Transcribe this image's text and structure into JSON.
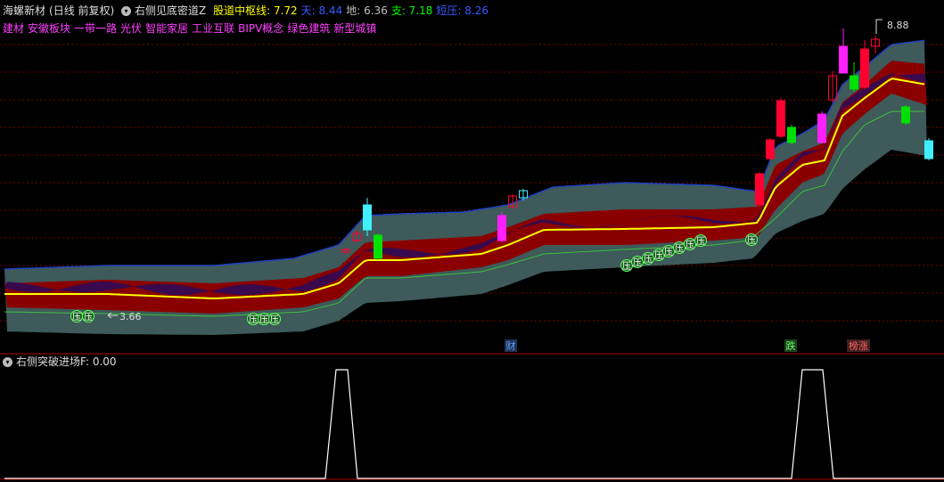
{
  "main_header": {
    "stock_name": "海螺新材",
    "period": "(日线 前复权)",
    "indicator": "右侧见底密道Z",
    "items": [
      {
        "label": "股道中枢线:",
        "value": "7.72",
        "color": "#ffff00"
      },
      {
        "label": "天:",
        "value": "8.44",
        "color": "#3a5bff"
      },
      {
        "label": "地:",
        "value": "6.36",
        "color": "#c0c0c0"
      },
      {
        "label": "支:",
        "value": "7.18",
        "color": "#00ff00"
      },
      {
        "label": "短压:",
        "value": "8.26",
        "color": "#3a5bff"
      }
    ]
  },
  "tags": [
    "建材",
    "安徽板块",
    "一带一路",
    "光伏",
    "智能家居",
    "工业互联",
    "BIPV概念",
    "绿色建筑",
    "新型城镇"
  ],
  "annotations": {
    "high_price": "8.88",
    "low_price": "3.66",
    "pressure_label": "压",
    "signals": [
      "财",
      "跌",
      "榜涨"
    ]
  },
  "sub_header": {
    "indicator": "右侧突破进场F",
    "value": ": 0.00"
  },
  "colors": {
    "background": "#000000",
    "grid": "#7a0000",
    "up_candle": "#ff0030",
    "down_candle": "#00e000",
    "magenta_candle": "#ff20ff",
    "cyan_candle": "#40f0ff",
    "center_line": "#ffff00",
    "outer_band": "#3e5a5a",
    "inner_band": "#8a0000",
    "wave": "#2a0a5a",
    "support_line": "#40c040",
    "top_line": "#2040c0"
  }
}
